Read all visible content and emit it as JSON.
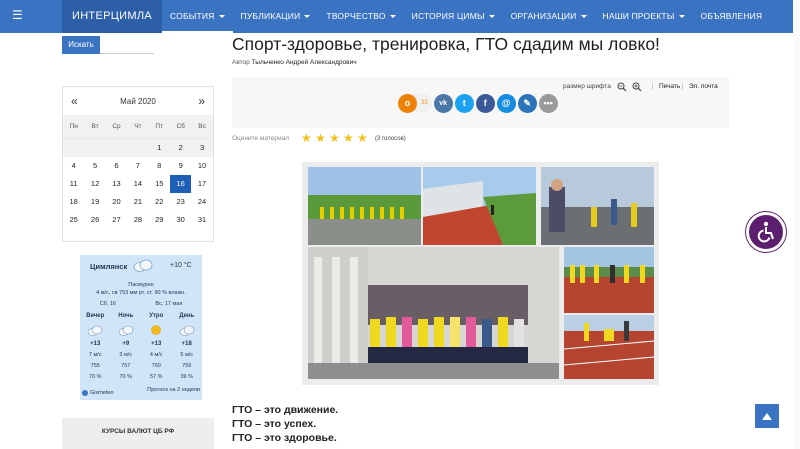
{
  "nav": {
    "brand": "ИНТЕРЦИМЛА",
    "items": [
      {
        "label": "СОБЫТИЯ",
        "dropdown": true,
        "active": true
      },
      {
        "label": "ПУБЛИКАЦИИ",
        "dropdown": true
      },
      {
        "label": "ТВОРЧЕСТВО",
        "dropdown": true
      },
      {
        "label": "ИСТОРИЯ ЦИМЫ",
        "dropdown": true
      },
      {
        "label": "ОРГАНИЗАЦИИ",
        "dropdown": true
      },
      {
        "label": "НАШИ ПРОЕКТЫ",
        "dropdown": true
      },
      {
        "label": "ОБЪЯВЛЕНИЯ",
        "dropdown": false
      }
    ]
  },
  "search": {
    "button": "Искать"
  },
  "calendar": {
    "month": "Май 2020",
    "prev": "«",
    "next": "»",
    "weekdays": [
      "Пн",
      "Вт",
      "Ср",
      "Чт",
      "Пт",
      "Сб",
      "Вс"
    ],
    "rows": [
      [
        "",
        "",
        "",
        "",
        "1",
        "2",
        "3"
      ],
      [
        "4",
        "5",
        "6",
        "7",
        "8",
        "9",
        "10"
      ],
      [
        "11",
        "12",
        "13",
        "14",
        "15",
        "16",
        "17"
      ],
      [
        "18",
        "19",
        "20",
        "21",
        "22",
        "23",
        "24"
      ],
      [
        "25",
        "26",
        "27",
        "28",
        "29",
        "30",
        "31"
      ]
    ],
    "today": "16"
  },
  "weather": {
    "city": "Цимлянск",
    "temp": "+10 °C",
    "condition": "Пасмурно",
    "details": "4 м/с, св   753 мм рт. ст.   90 % влажн.",
    "days": [
      "Сб, 16",
      "Вс, 17 мая"
    ],
    "columns": [
      {
        "part": "Вечер",
        "icon": "cloud-icon",
        "temp": "+13",
        "wind": "7 м/с",
        "pressure": "755",
        "humidity": "70 %"
      },
      {
        "part": "Ночь",
        "icon": "cloud-icon",
        "temp": "+9",
        "wind": "3 м/с",
        "pressure": "757",
        "humidity": "70 %"
      },
      {
        "part": "Утро",
        "icon": "sun-icon",
        "temp": "+13",
        "wind": "4 м/с",
        "pressure": "760",
        "humidity": "57 %"
      },
      {
        "part": "День",
        "icon": "cloud-icon",
        "temp": "+18",
        "wind": "5 м/с",
        "pressure": "759",
        "humidity": "39 %"
      }
    ],
    "brand": "Gismeteo",
    "forecast_link": "Прогноз на 2 недели"
  },
  "currency": {
    "title": "КУРСЫ ВАЛЮТ ЦБ РФ"
  },
  "article": {
    "title": "Спорт-здоровье, тренировка, ГТО сдадим мы ловко!",
    "author_prefix": "Автор",
    "author_name": "Тыльченко Андрей Александрович",
    "font_size_label": "размер шрифта",
    "print": "Печать",
    "email": "Эл. почта",
    "ok_count": "33",
    "rating_label": "Оцените материал",
    "stars": 5,
    "votes": "(3 голосов)",
    "lines": [
      "ГТО – это движение.",
      "ГТО – это успех.",
      "ГТО – это здоровье."
    ]
  },
  "colors": {
    "nav_bg": "#3b73c3",
    "brand_bg": "#2c5fa8",
    "today_bg": "#1e5eb4",
    "weather_bg": "#d0e5f7",
    "accessibility": "#5c1e6e",
    "ok": "#ee8208",
    "vk": "#4a76a8",
    "twitter": "#1da1f2",
    "facebook": "#3b5998",
    "mail": "#168de2",
    "livejournal": "#2d73b9",
    "more": "#9a9a9a"
  }
}
